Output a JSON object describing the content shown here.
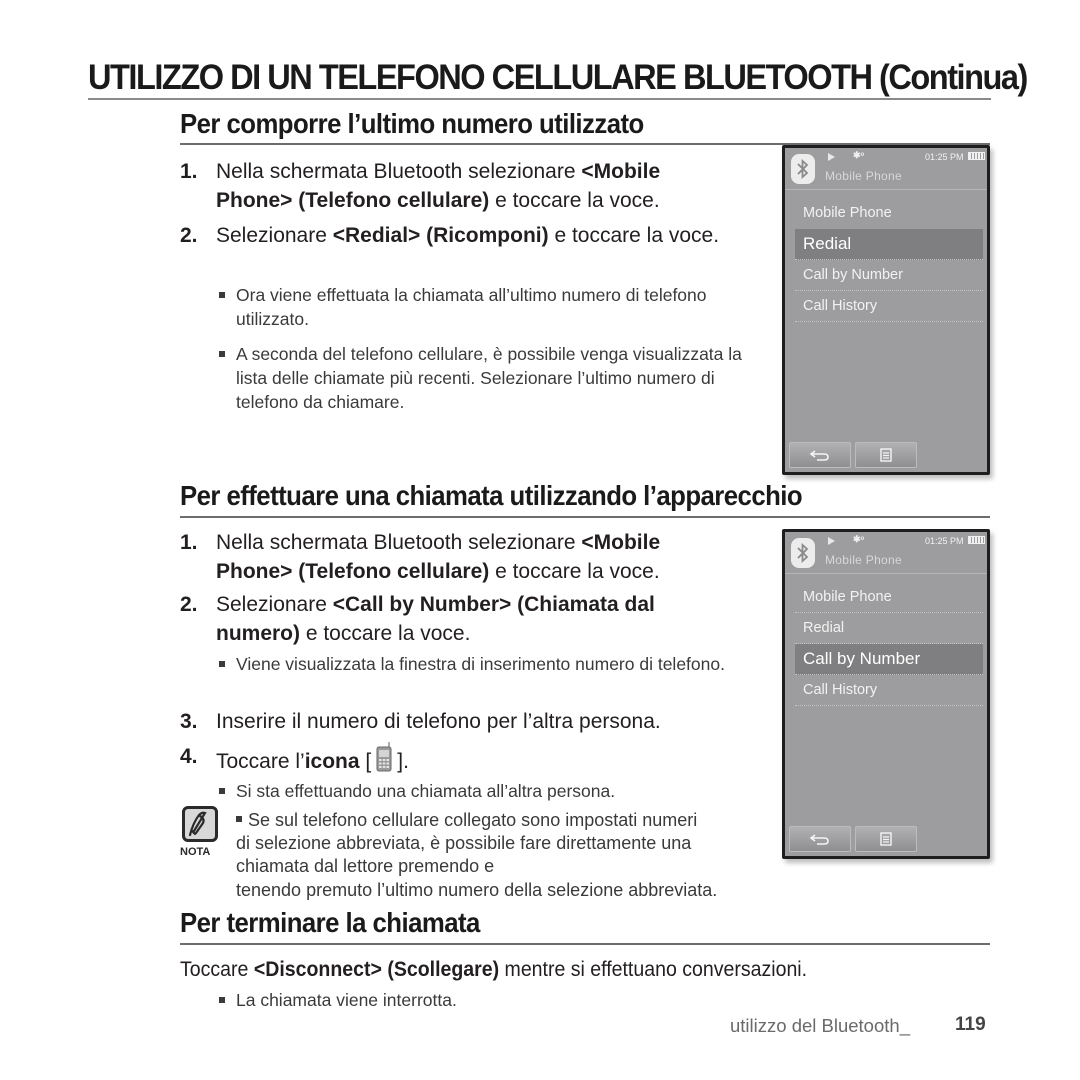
{
  "header": {
    "title": "UTILIZZO DI UN TELEFONO CELLULARE BLUETOOTH (Continua)"
  },
  "sections": [
    {
      "title": "Per comporre l’ultimo numero utilizzato",
      "steps": [
        {
          "num": "1.",
          "parts": [
            "Nella schermata Bluetooth selezionare ",
            "<Mobile Phone> (Telefono cellulare)",
            " e toccare la voce."
          ]
        },
        {
          "num": "2.",
          "parts": [
            "Selezionare ",
            "<Redial> (Ricomponi)",
            " e toccare la voce."
          ]
        }
      ],
      "bullets": [
        "Ora viene effettuata la chiamata all’ultimo numero di telefono utilizzato.",
        "A seconda del telefono cellulare, è possibile venga visualizzata la lista delle chiamate più recenti. Selezionare l’ultimo numero di telefono da chiamare."
      ]
    },
    {
      "title": "Per effettuare una chiamata utilizzando l’apparecchio",
      "steps": [
        {
          "num": "1.",
          "parts": [
            "Nella schermata Bluetooth selezionare ",
            "<Mobile Phone> (Telefono cellulare)",
            " e toccare la voce."
          ]
        },
        {
          "num": "2.",
          "parts": [
            "Selezionare ",
            "<Call by Number> (Chiamata dal numero)",
            " e toccare la voce."
          ]
        },
        {
          "num": "3.",
          "parts": [
            "Inserire il numero di telefono per l’altra persona."
          ]
        },
        {
          "num": "4.",
          "parts": [
            "Toccare l’",
            "icona",
            " [",
            "]."
          ]
        }
      ],
      "bullets": [
        "Viene visualizzata la finestra di inserimento numero di telefono.",
        "Si sta effettuando una chiamata all’altra persona."
      ],
      "note": {
        "label": "NOTA",
        "text": "Se sul telefono cellulare collegato sono impostati numeri di selezione abbreviata, è possibile fare direttamente una chiamata dal lettore premendo e",
        "text_last": "tenendo premuto l’ultimo numero della selezione abbreviata."
      }
    },
    {
      "title": "Per terminare la chiamata",
      "steps": [
        {
          "num": "",
          "parts": [
            "Toccare ",
            "<Disconnect> (Scollegare)",
            " mentre si effettuano conversazioni."
          ]
        }
      ],
      "bullets": [
        "La chiamata viene interrotta."
      ]
    }
  ],
  "devices": [
    {
      "clock": "01:25 PM",
      "title": "Mobile Phone",
      "items": [
        "Mobile Phone",
        "Redial",
        "Call by Number",
        "Call History"
      ],
      "selected_index": 1
    },
    {
      "clock": "01:25 PM",
      "title": "Mobile Phone",
      "items": [
        "Mobile Phone",
        "Redial",
        "Call by Number",
        "Call History"
      ],
      "selected_index": 2
    }
  ],
  "footer": {
    "label": "utilizzo del Bluetooth_ ",
    "page": "119"
  },
  "colors": {
    "device_bg": "#9d9d9f",
    "device_selected": "#7f7f81",
    "text": "#231f20"
  }
}
